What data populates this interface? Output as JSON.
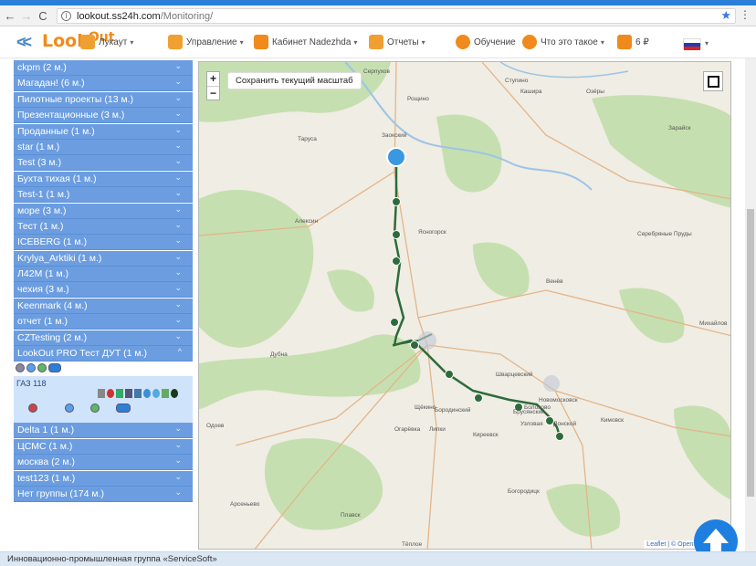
{
  "browser": {
    "url_host": "lookout.ss24h.com",
    "url_path": "/Monitoring/"
  },
  "app": {
    "logo_left": "Look",
    "logo_right": "Out",
    "toolbar": [
      {
        "label": "Лукаут",
        "icon": "user-icon",
        "caret": true
      },
      {
        "label": "Управление",
        "icon": "ship-wheel-icon",
        "caret": true
      },
      {
        "label": "Кабинет  Nadezhda",
        "icon": "key-icon",
        "caret": true
      },
      {
        "label": "Отчеты",
        "icon": "report-icon",
        "caret": true
      },
      {
        "label": "Обучение",
        "icon": "graduation-icon",
        "caret": false
      },
      {
        "label": "Что это такое",
        "icon": "info-icon",
        "caret": true
      },
      {
        "label": "6 ₽",
        "icon": "wallet-icon",
        "caret": false
      }
    ]
  },
  "sidebar": {
    "groups_top": [
      "ckpm (2 м.)",
      "Магадан! (6 м.)",
      "Пилотные проекты (13 м.)",
      "Презентационные (3 м.)",
      "Проданные (1 м.)",
      "star (1 м.)",
      "Test (3 м.)",
      "Бухта тихая (1 м.)",
      "Test-1 (1 м.)",
      "море (3 м.)",
      "Тест (1 м.)",
      "ICEBERG (1 м.)",
      "Krylya_Arktiki (1 м.)",
      "Л42М (1 м.)",
      "чехия (3 м.)",
      "Keenmark (4 м.)",
      "отчет (1 м.)",
      "CZTesting (2 м.)"
    ],
    "expanded_group": "LookOut PRO Тест ДУТ (1 м.)",
    "vehicle_name": "ГАЗ 118",
    "groups_bottom": [
      "Delta 1 (1 м.)",
      "ЦСМС (1 м.)",
      "москва (2 м.)",
      "test123 (1 м.)",
      "Нет группы (174 м.)"
    ]
  },
  "map": {
    "zoom_in": "+",
    "zoom_out": "−",
    "save_scale_label": "Сохранить текущий масштаб",
    "attribution": "Leaflet | © OpenStreetMap c",
    "places": [
      "Серпухов",
      "Ступино",
      "Кашира",
      "Озёры",
      "Тарусa",
      "Заокский",
      "Зарайск",
      "Алексин",
      "Ясногорск",
      "Серебряные Пруды",
      "Венёв",
      "Михайлов",
      "Дубна",
      "Щёкино",
      "Бородинский",
      "Узловая",
      "Новомосковск",
      "Донской",
      "Кимовск",
      "Огарёвка",
      "Липки",
      "Киреевск",
      "Богородицк",
      "Одоев",
      "Арсеньево",
      "Плавск",
      "Тёплое",
      "Шварцевский",
      "Брусянский",
      "Болохово",
      "Рощино"
    ]
  },
  "footer": {
    "text": "Инновационно-промышленная группа «ServiceSoft»"
  },
  "colors": {
    "sidebar_group": "#6b9de0",
    "route": "#2e6b3a",
    "accent_blue": "#1e7fe0",
    "logo_orange": "#f08a1c"
  }
}
